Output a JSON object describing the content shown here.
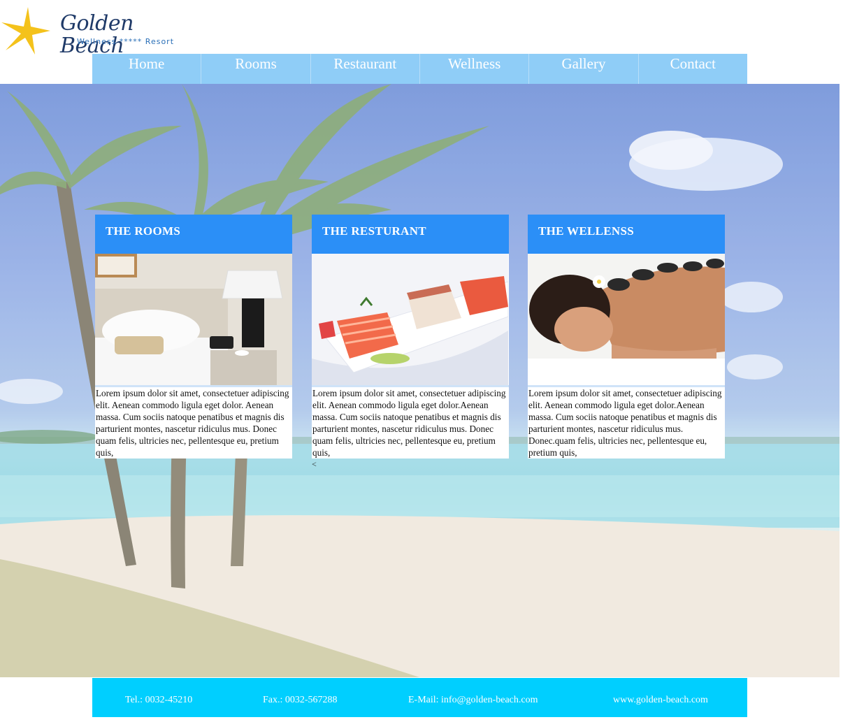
{
  "brand": {
    "name": "Golden Beach",
    "tagline": "Wellness ***** Resort",
    "accent": "#f4c21b"
  },
  "nav": [
    {
      "label": "Home"
    },
    {
      "label": "Rooms"
    },
    {
      "label": "Restaurant"
    },
    {
      "label": "Wellness"
    },
    {
      "label": "Gallery"
    },
    {
      "label": "Contact"
    }
  ],
  "cards": [
    {
      "title": "THE ROOMS",
      "image": "hotel-room-photo",
      "text": "Lorem ipsum dolor sit amet, consectetuer adipiscing elit. Aenean commodo ligula eget dolor. Aenean massa. Cum sociis natoque penatibus et magnis dis parturient montes, nascetur ridiculus mus. Donec quam felis, ultricies nec, pellentesque eu, pretium quis,"
    },
    {
      "title": "THE RESTURANT",
      "image": "salmon-dish-photo",
      "text": "Lorem ipsum dolor sit amet, consectetuer adipiscing elit. Aenean commodo ligula eget dolor.Aenean massa. Cum sociis natoque penatibus et magnis dis parturient montes, nascetur ridiculus mus. Donec quam felis, ultricies nec, pellentesque eu, pretium quis,"
    },
    {
      "title": "THE WELLENSS",
      "image": "hot-stone-massage-photo",
      "text": "Lorem ipsum dolor sit amet, consectetuer adipiscing elit. Aenean commodo ligula eget dolor.Aenean massa. Cum sociis natoque penatibus et magnis dis parturient montes, nascetur ridiculus mus. Donec.quam felis, ultricies nec, pellentesque eu, pretium quis,"
    }
  ],
  "stray_char": "<",
  "footer": {
    "tel": "Tel.: 0032-45210",
    "fax": "Fax.: 0032-567288",
    "email": "E-Mail: info@golden-beach.com",
    "website": "www.golden-beach.com"
  },
  "colors": {
    "nav_bg": "#8fcdf7",
    "card_header": "#2b8ff7",
    "footer_bg": "#00cfff"
  }
}
